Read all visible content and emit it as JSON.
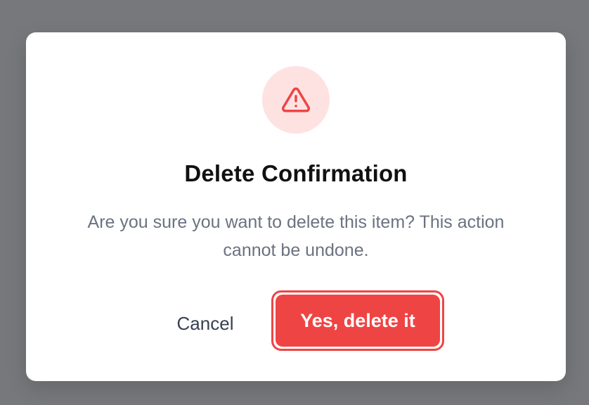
{
  "dialog": {
    "icon": "warning-triangle-icon",
    "title": "Delete Confirmation",
    "message": "Are you sure you want to delete this item? This action cannot be undone.",
    "cancel_label": "Cancel",
    "confirm_label": "Yes, delete it"
  },
  "colors": {
    "overlay": "#77787b",
    "danger": "#ef4444",
    "danger_soft": "#fee2e2",
    "text_primary": "#111111",
    "text_muted": "#6b7280",
    "text_secondary": "#374151"
  }
}
